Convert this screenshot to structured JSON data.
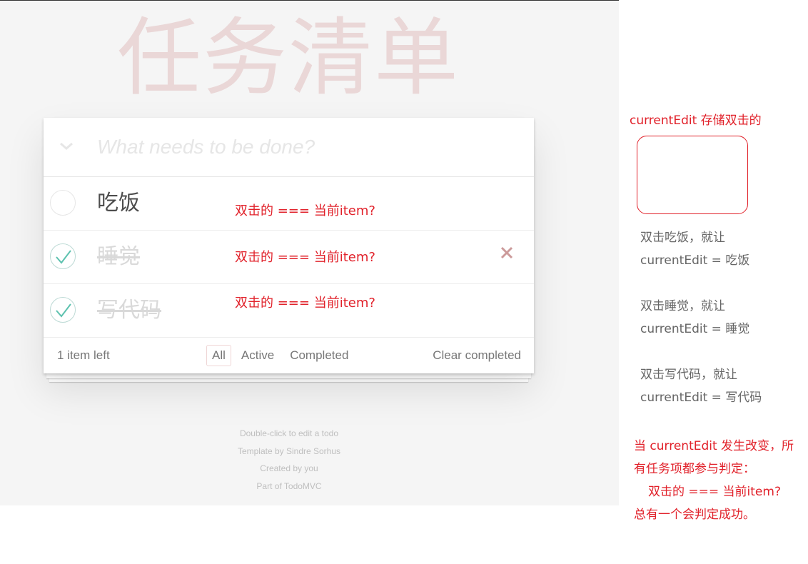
{
  "app": {
    "title": "任务清单",
    "input_placeholder": "What needs to be done?",
    "todos": [
      {
        "label": "吃饭",
        "completed": false,
        "note": "双击的 === 当前item?"
      },
      {
        "label": "睡觉",
        "completed": true,
        "note": "双击的 === 当前item?"
      },
      {
        "label": "写代码",
        "completed": true,
        "note": "双击的 === 当前item?"
      }
    ],
    "footer": {
      "count": "1 item left",
      "filters": [
        "All",
        "Active",
        "Completed"
      ],
      "selected_filter": "All",
      "clear": "Clear completed"
    },
    "info": [
      "Double-click to edit a todo",
      "Template by Sindre Sorhus",
      "Created by you",
      "Part of TodoMVC"
    ]
  },
  "annotations": {
    "box_caption": "currentEdit 存储双击的",
    "lines": [
      [
        "双击吃饭，就让",
        "currentEdit = 吃饭"
      ],
      [
        "双击睡觉，就让",
        "currentEdit = 睡觉"
      ],
      [
        "双击写代码，就让",
        "currentEdit = 写代码"
      ]
    ],
    "summary": [
      "当 currentEdit 发生改变，所",
      "有任务项都参与判定：",
      "双击的 === 当前item?",
      "总有一个会判定成功。"
    ]
  },
  "colors": {
    "accent": "#e1212a",
    "check": "#5dc2af",
    "destroy": "#cc9a9a",
    "title": "#af2f2f"
  }
}
